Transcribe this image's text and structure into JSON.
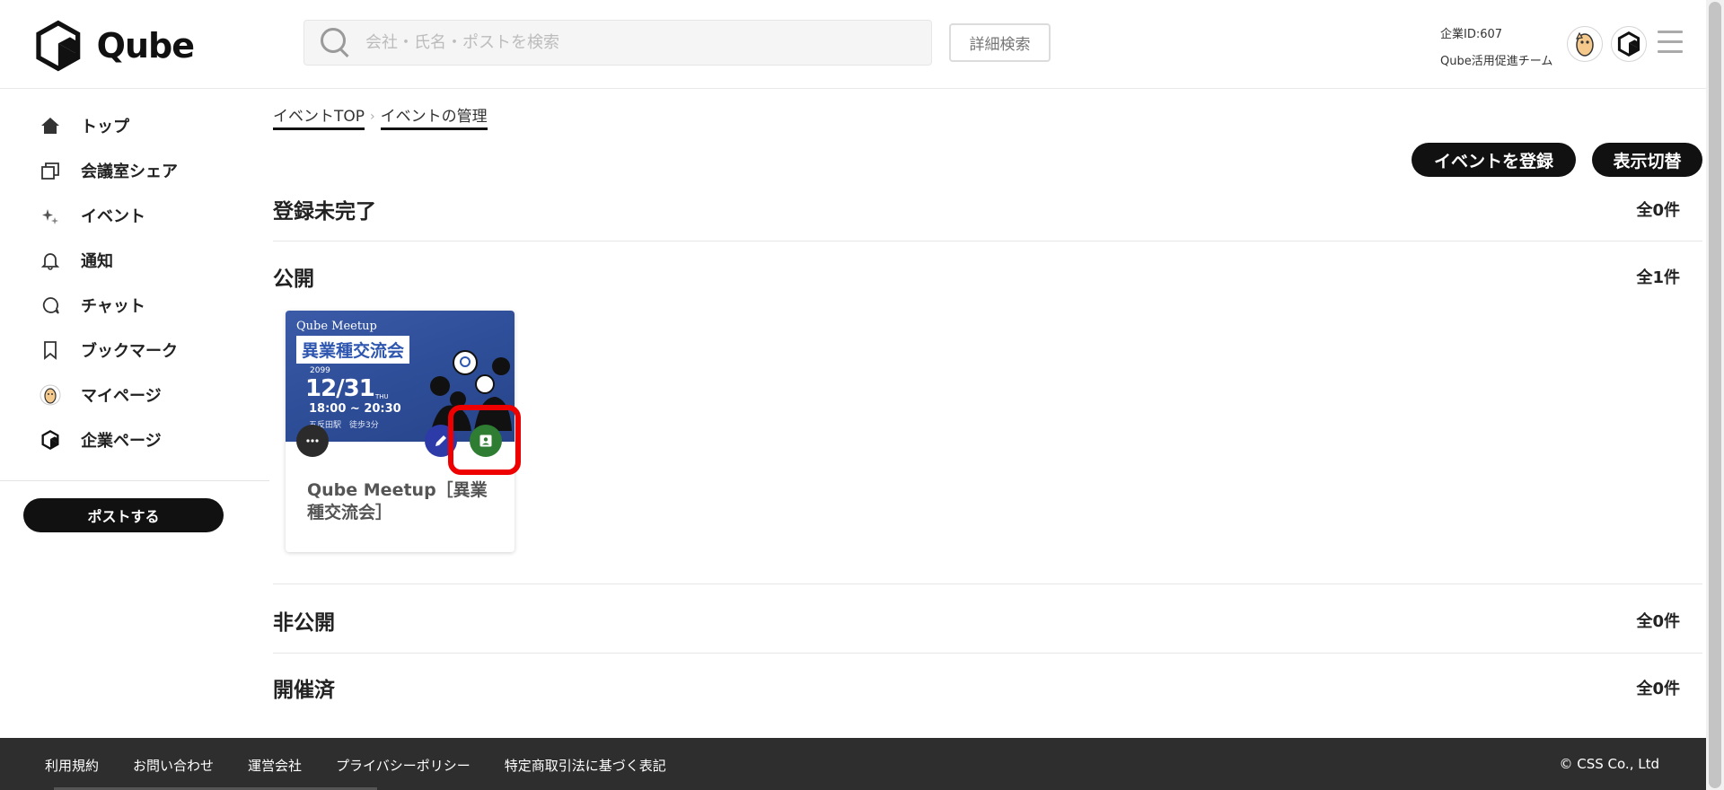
{
  "header": {
    "logo_text": "Qube",
    "search_placeholder": "会社・氏名・ポストを検索",
    "advanced_search_label": "詳細検索",
    "company_id": "企業ID:607",
    "team_name": "Qube活用促進チーム"
  },
  "sidebar": {
    "items": [
      {
        "label": "トップ",
        "icon": "home-icon"
      },
      {
        "label": "会議室シェア",
        "icon": "meeting-room-icon"
      },
      {
        "label": "イベント",
        "icon": "sparkle-icon"
      },
      {
        "label": "通知",
        "icon": "bell-icon"
      },
      {
        "label": "チャット",
        "icon": "chat-bubble-icon"
      },
      {
        "label": "ブックマーク",
        "icon": "bookmark-icon"
      },
      {
        "label": "マイページ",
        "icon": "user-avatar-icon"
      },
      {
        "label": "企業ページ",
        "icon": "company-logo-icon"
      }
    ],
    "post_button_label": "ポストする"
  },
  "breadcrumb": {
    "items": [
      "イベントTOP",
      "イベントの管理"
    ],
    "separator": "›"
  },
  "actions": {
    "register_label": "イベントを登録",
    "switch_view_label": "表示切替"
  },
  "sections": {
    "incomplete": {
      "title": "登録未完了",
      "count": "全0件"
    },
    "public": {
      "title": "公開",
      "count": "全1件"
    },
    "private": {
      "title": "非公開",
      "count": "全0件"
    },
    "finished": {
      "title": "開催済",
      "count": "全0件"
    }
  },
  "event_card": {
    "title": "Qube Meetup［異業種交流会］",
    "image": {
      "brand": "Qube Meetup",
      "banner": "異業種交流会",
      "year": "2099",
      "date": "12/31",
      "day_of_week": "THU",
      "time": "18:00 ~ 20:30",
      "place": "五反田駅　徒歩3分"
    },
    "actions": [
      "more-icon",
      "pencil-icon",
      "person-badge-icon"
    ]
  },
  "footer": {
    "links": [
      "利用規約",
      "お問い合わせ",
      "運営会社",
      "プライバシーポリシー",
      "特定商取引法に基づく表記"
    ],
    "copyright": "© CSS Co., Ltd"
  },
  "colors": {
    "primary": "#111111",
    "highlight": "#ef0000",
    "view_button": "#2e7d32",
    "edit_button": "#2d3ba8",
    "footer_bg": "#2e2e2e"
  }
}
